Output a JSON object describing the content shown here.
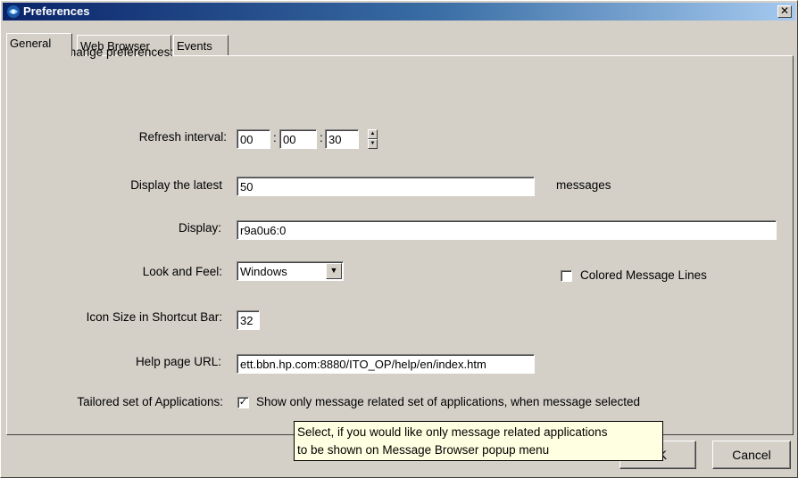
{
  "window": {
    "title": "Preferences",
    "close_glyph": "✕"
  },
  "tabs": [
    {
      "label": "General"
    },
    {
      "label": "Web Browser"
    },
    {
      "label": "Events"
    }
  ],
  "general": {
    "heading": "Change preferences:",
    "refresh": {
      "label": "Refresh interval:",
      "hours": "00",
      "minutes": "00",
      "seconds": "30",
      "sep": ":"
    },
    "latest": {
      "label": "Display the latest",
      "value": "50",
      "suffix": "messages"
    },
    "display": {
      "label": "Display:",
      "value": "r9a0u6:0"
    },
    "look": {
      "label": "Look and Feel:",
      "value": "Windows"
    },
    "colored_lines": {
      "label": "Colored Message Lines",
      "checked": false
    },
    "icon_size": {
      "label": "Icon Size in Shortcut Bar:",
      "value": "32"
    },
    "help_url": {
      "label": "Help page URL:",
      "value": "ett.bbn.hp.com:8880/ITO_OP/help/en/index.htm"
    },
    "tailored": {
      "label": "Tailored set of Applications:",
      "checkbox_label": "Show only message related set of applications, when message selected",
      "checked": true
    }
  },
  "tooltip": {
    "line1": "Select, if you would like only message related applications",
    "line2": "to be shown on Message Browser popup menu"
  },
  "buttons": {
    "ok": "OK",
    "cancel": "Cancel"
  },
  "icons": {
    "app": "app-icon",
    "close": "close-icon",
    "spin_up": "spin-up-icon",
    "spin_down": "spin-down-icon",
    "dropdown": "chevron-down-icon",
    "check": "check-icon"
  }
}
